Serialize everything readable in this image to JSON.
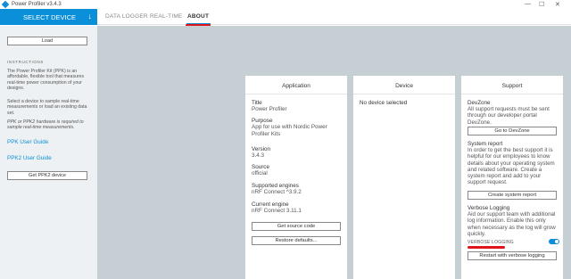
{
  "window": {
    "title": "Power Profiler v3.4.3",
    "controls": [
      "—",
      "☐",
      "✕"
    ]
  },
  "header": {
    "select_device": "SELECT DEVICE",
    "tabs": [
      {
        "label": "DATA LOGGER"
      },
      {
        "label": "REAL-TIME"
      },
      {
        "label": "ABOUT"
      }
    ],
    "active_tab": "ABOUT"
  },
  "sidebar": {
    "load_label": "Load",
    "instructions_heading": "INSTRUCTIONS",
    "instructions": [
      "The Power Profiler Kit (PPK) is an affordable, flexible tool that measures real-time power consumption of your designs.",
      "Select a device to sample real-time measurements or load an existing data set.",
      "PPK or PPK2 hardware is required to sample real-time measurements."
    ],
    "links": [
      "PPK User Guide",
      "PPK2 User Guide"
    ],
    "get_ppk2_label": "Get PPK2 device"
  },
  "application": {
    "title": "Application",
    "fields": [
      {
        "label": "Title",
        "value": "Power Profiler"
      },
      {
        "label": "Purpose",
        "value": "App for use with Nordic Power Profiler Kits"
      },
      {
        "label": "Version",
        "value": "3.4.3"
      },
      {
        "label": "Source",
        "value": "official"
      },
      {
        "label": "Supported engines",
        "value": "nRF Connect ^3.9.2"
      },
      {
        "label": "Current engine",
        "value": "nRF Connect 3.11.1"
      }
    ],
    "get_source_label": "Get source code",
    "restore_label": "Restore defaults..."
  },
  "device": {
    "title": "Device",
    "status": "No device selected"
  },
  "support": {
    "title": "Support",
    "devzone_heading": "DevZone",
    "devzone_text": "All support requests must be sent through our developer portal DevZone.",
    "devzone_button": "Go to DevZone",
    "report_heading": "System report",
    "report_text": "In order to get the best support it is helpful for our employees to know details about your operating system and related software. Create a system report and add to your support request.",
    "report_button": "Create system report",
    "verbose_heading": "Verbose Logging",
    "verbose_text": "Aid our support team with additional log information. Enable this only when necessary as the log will grow quickly.",
    "verbose_toggle_label": "VERBOSE LOGGING",
    "verbose_enabled": true,
    "restart_button": "Restart with verbose logging"
  },
  "colors": {
    "accent": "#0a8fd8",
    "annotation": "#e0151c",
    "sidebar_bg": "#eef1f3",
    "main_bg": "#c6cfd4"
  }
}
